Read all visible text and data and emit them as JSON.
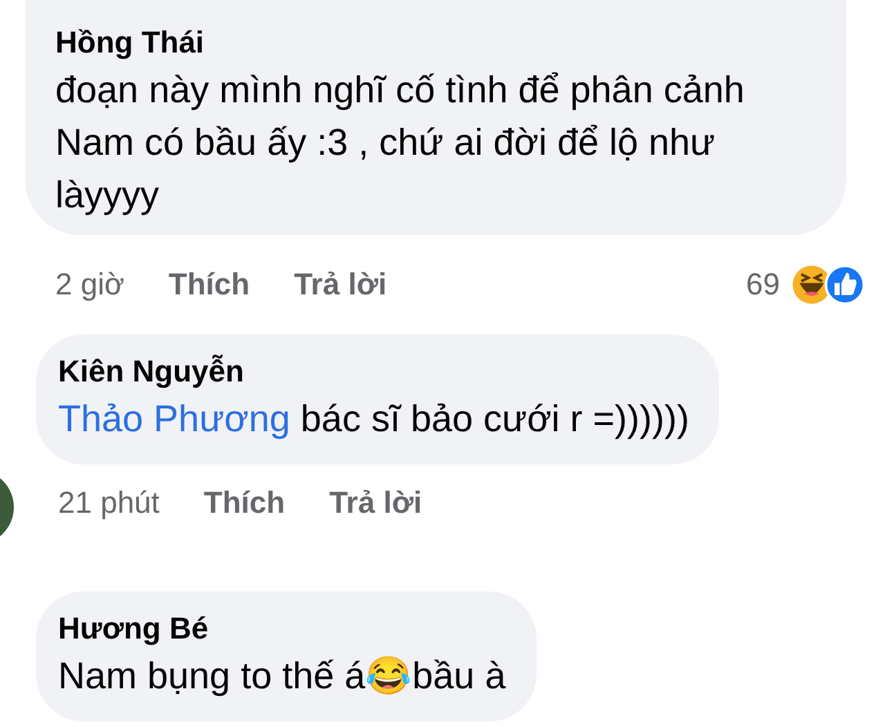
{
  "comments": [
    {
      "author": "Hồng Thái",
      "text": "đoạn này mình nghĩ cố tình để phân cảnh Nam có bầu ấy :3 , chứ ai đời để lộ như làyyyy",
      "meta": {
        "time": "2 giờ",
        "actions": [
          "Thích",
          "Trả lời"
        ],
        "reactions": {
          "count": "69"
        }
      }
    },
    {
      "author": "Kiên Nguyễn",
      "mention": "Thảo Phương",
      "text": "bác sĩ bảo cưới r =))))))",
      "meta": {
        "time": "21 phút",
        "actions": [
          "Thích",
          "Trả lời"
        ]
      }
    },
    {
      "author": "Hương Bé",
      "text": "Nam bụng to thế á😂bầu à"
    }
  ]
}
